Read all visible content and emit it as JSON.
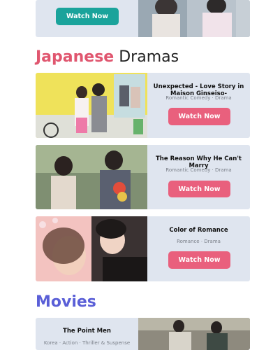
{
  "top_card": {
    "button": "Watch Now"
  },
  "japanese_section": {
    "accent": "Japanese",
    "rest": "Dramas"
  },
  "dramas": [
    {
      "title": "Unexpected - Love Story in Maison Ginseiso-",
      "genre": "Romantic Comedy · Drama",
      "button": "Watch Now"
    },
    {
      "title": "The Reason Why He Can't Marry",
      "genre": "Romantic Comedy · Drama",
      "button": "Watch Now"
    },
    {
      "title": "Color of Romance",
      "genre": "Romance · Drama",
      "button": "Watch Now"
    }
  ],
  "movies_section": {
    "title": "Movies"
  },
  "movie_card": {
    "title": "The Point Men",
    "genre": "Korea · Action · Thriller & Suspense"
  },
  "colors": {
    "teal": "#1aa39b",
    "pink": "#e9607d",
    "accent_red": "#e0566f",
    "movies_blue": "#5a5fd7",
    "card_bg": "#dfe5ef"
  }
}
